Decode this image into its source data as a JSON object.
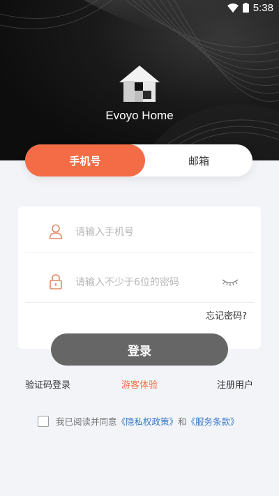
{
  "statusbar": {
    "time": "5:38",
    "icons": [
      "wifi-icon",
      "battery-icon"
    ]
  },
  "app": {
    "name": "Evoyo Home"
  },
  "tabs": [
    {
      "label": "手机号",
      "active": true
    },
    {
      "label": "邮箱",
      "active": false
    }
  ],
  "form": {
    "phone": {
      "placeholder": "请输入手机号",
      "icon": "user-icon"
    },
    "password": {
      "placeholder": "请输入不少于6位的密码",
      "icon": "lock-icon",
      "toggle_icon": "eye-closed-icon"
    },
    "forgot": "忘记密码?"
  },
  "login_button": "登录",
  "links": {
    "sms_login": "验证码登录",
    "guest": "游客体验",
    "register": "注册用户"
  },
  "agreement": {
    "prefix": "我已阅读并同意",
    "privacy": "《隐私权政策》",
    "and": "和",
    "terms": "《服务条款》",
    "checked": false
  },
  "colors": {
    "accent": "#f36c45",
    "link": "#3a79c9",
    "button_disabled": "#666666"
  }
}
